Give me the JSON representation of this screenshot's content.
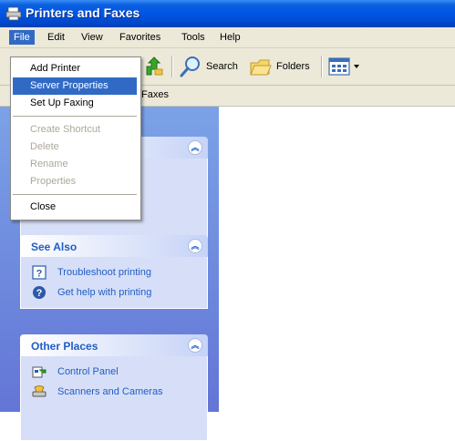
{
  "window": {
    "title": "Printers and Faxes"
  },
  "menubar": {
    "items": [
      "File",
      "Edit",
      "View",
      "Favorites",
      "Tools",
      "Help"
    ],
    "active": "File"
  },
  "toolbar": {
    "search_label": "Search",
    "folders_label": "Folders"
  },
  "address": {
    "text": "Faxes"
  },
  "file_menu": {
    "items": [
      {
        "label": "Add Printer",
        "enabled": true
      },
      {
        "label": "Server Properties",
        "enabled": true,
        "highlighted": true
      },
      {
        "label": "Set Up Faxing",
        "enabled": true
      },
      {
        "label": "Create Shortcut",
        "enabled": false
      },
      {
        "label": "Delete",
        "enabled": false
      },
      {
        "label": "Rename",
        "enabled": false
      },
      {
        "label": "Properties",
        "enabled": false
      },
      {
        "label": "Close",
        "enabled": true
      }
    ]
  },
  "see_also": {
    "title": "See Also",
    "links": [
      "Troubleshoot printing",
      "Get help with printing"
    ]
  },
  "other_places": {
    "title": "Other Places",
    "links": [
      "Control Panel",
      "Scanners and Cameras"
    ]
  },
  "icons": {
    "title": "printer-icon",
    "forward": "forward-icon",
    "up": "up-folder-icon",
    "search": "search-icon",
    "folders": "folders-icon",
    "views": "views-icon",
    "collapse": "collapse-chevron-icon",
    "help": "help-icon",
    "question": "question-icon",
    "control_panel": "control-panel-icon",
    "scanner": "scanner-icon"
  },
  "colors": {
    "titlebar": "#0055e5",
    "menu_highlight": "#316ac5",
    "task_pane": "#6375d6",
    "link": "#215dc6"
  }
}
